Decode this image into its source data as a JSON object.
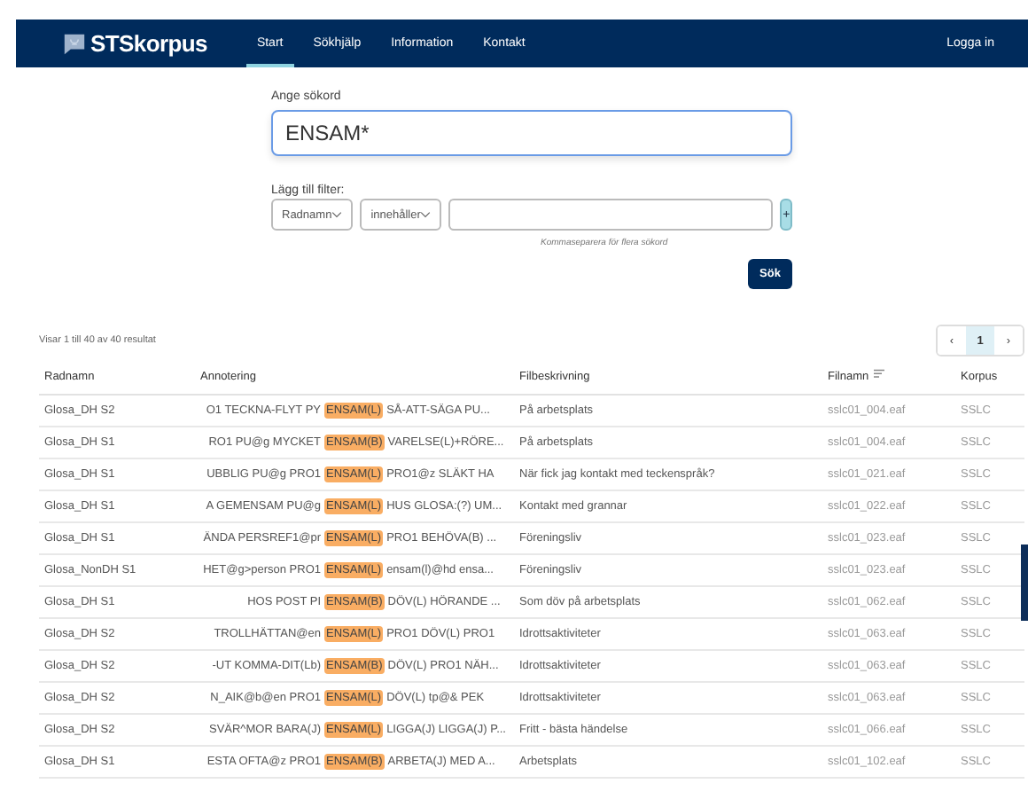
{
  "navbar": {
    "logo": "STSkorpus",
    "tabs": [
      {
        "label": "Start",
        "selected": true
      },
      {
        "label": "Sökhjälp",
        "selected": false
      },
      {
        "label": "Information",
        "selected": false
      },
      {
        "label": "Kontakt",
        "selected": false
      }
    ],
    "login": "Logga in"
  },
  "search": {
    "label": "Ange sökord",
    "value": "ENSAM*"
  },
  "filter": {
    "label": "Lägg till filter:",
    "field": "Radnamn",
    "operator": "innehåller",
    "add": "+",
    "hint": "Kommaseparera för flera sökord"
  },
  "submit": "Sök",
  "results": {
    "summary": "Visar 1 till 40 av 40 resultat",
    "pager": [
      {
        "label": "‹",
        "selected": false
      },
      {
        "label": "1",
        "selected": true
      },
      {
        "label": "›",
        "selected": false
      }
    ],
    "columns": [
      {
        "label": "Radnamn",
        "sortable": false
      },
      {
        "label": "Annotering",
        "sortable": false
      },
      {
        "label": "Filbeskrivning",
        "sortable": false
      },
      {
        "label": "Filnamn",
        "sortable": true
      },
      {
        "label": "Korpus",
        "sortable": false
      }
    ],
    "rows": [
      {
        "radnamn": "Glosa_DH S2",
        "before": "O1 TECKNA-FLYT PY",
        "match": "ENSAM(L)",
        "after": "SÅ-ATT-SÄGA PU...",
        "description": "På arbetsplats",
        "file": "sslc01_004.eaf",
        "corpus": "SSLC"
      },
      {
        "radnamn": "Glosa_DH S1",
        "before": "RO1 PU@g MYCKET",
        "match": "ENSAM(B)",
        "after": "VARELSE(L)+RÖRE...",
        "description": "På arbetsplats",
        "file": "sslc01_004.eaf",
        "corpus": "SSLC"
      },
      {
        "radnamn": "Glosa_DH S1",
        "before": "UBBLIG PU@g PRO1",
        "match": "ENSAM(L)",
        "after": "PRO1@z SLÄKT HA",
        "description": "När fick jag kontakt med teckenspråk?",
        "file": "sslc01_021.eaf",
        "corpus": "SSLC"
      },
      {
        "radnamn": "Glosa_DH S1",
        "before": "A GEMENSAM PU@g",
        "match": "ENSAM(L)",
        "after": "HUS GLOSA:(?) UM...",
        "description": "Kontakt med grannar",
        "file": "sslc01_022.eaf",
        "corpus": "SSLC"
      },
      {
        "radnamn": "Glosa_DH S1",
        "before": "ÄNDA PERSREF1@pr",
        "match": "ENSAM(L)",
        "after": "PRO1 BEHÖVA(B) ...",
        "description": "Föreningsliv",
        "file": "sslc01_023.eaf",
        "corpus": "SSLC"
      },
      {
        "radnamn": "Glosa_NonDH S1",
        "before": "HET@g>person PRO1",
        "match": "ENSAM(L)",
        "after": "ensam(l)@hd ensa...",
        "description": "Föreningsliv",
        "file": "sslc01_023.eaf",
        "corpus": "SSLC"
      },
      {
        "radnamn": "Glosa_DH S1",
        "before": "HOS POST PI",
        "match": "ENSAM(B)",
        "after": "DÖV(L) HÖRANDE ...",
        "description": "Som döv på arbetsplats",
        "file": "sslc01_062.eaf",
        "corpus": "SSLC"
      },
      {
        "radnamn": "Glosa_DH S2",
        "before": "TROLLHÄTTAN@en",
        "match": "ENSAM(L)",
        "after": "PRO1 DÖV(L) PRO1",
        "description": "Idrottsaktiviteter",
        "file": "sslc01_063.eaf",
        "corpus": "SSLC"
      },
      {
        "radnamn": "Glosa_DH S2",
        "before": "-UT KOMMA-DIT(Lb)",
        "match": "ENSAM(B)",
        "after": "DÖV(L) PRO1 NÄH...",
        "description": "Idrottsaktiviteter",
        "file": "sslc01_063.eaf",
        "corpus": "SSLC"
      },
      {
        "radnamn": "Glosa_DH S2",
        "before": "N_AIK@b@en PRO1",
        "match": "ENSAM(L)",
        "after": "DÖV(L) tp@& PEK",
        "description": "Idrottsaktiviteter",
        "file": "sslc01_063.eaf",
        "corpus": "SSLC"
      },
      {
        "radnamn": "Glosa_DH S2",
        "before": "SVÄR^MOR BARA(J)",
        "match": "ENSAM(L)",
        "after": "LIGGA(J) LIGGA(J) P...",
        "description": "Fritt - bästa händelse",
        "file": "sslc01_066.eaf",
        "corpus": "SSLC"
      },
      {
        "radnamn": "Glosa_DH S1",
        "before": "ESTA OFTA@z PRO1",
        "match": "ENSAM(B)",
        "after": "ARBETA(J) MED A...",
        "description": "Arbetsplats",
        "file": "sslc01_102.eaf",
        "corpus": "SSLC"
      }
    ]
  }
}
